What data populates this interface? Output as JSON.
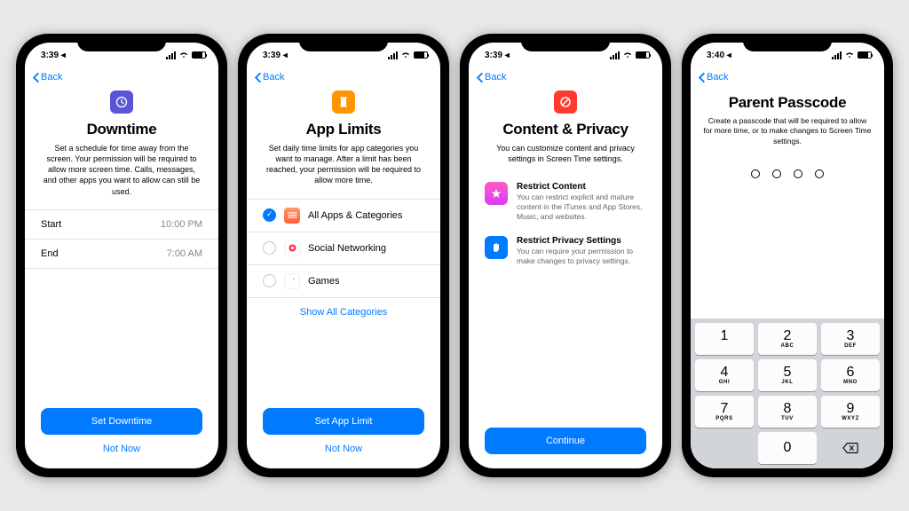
{
  "statusbar": {
    "time1": "3:39 ◂",
    "time4": "3:40 ◂"
  },
  "back_label": "Back",
  "phones": {
    "downtime": {
      "title": "Downtime",
      "desc": "Set a schedule for time away from the screen. Your permission will be required to allow more screen time. Calls, messages, and other apps you want to allow can still be used.",
      "start_label": "Start",
      "start_time": "10:00 PM",
      "end_label": "End",
      "end_time": "7:00 AM",
      "primary": "Set Downtime",
      "secondary": "Not Now"
    },
    "applimits": {
      "title": "App Limits",
      "desc": "Set daily time limits for app categories you want to manage. After a limit has been reached, your permission will be required to allow more time.",
      "cats": {
        "all": "All Apps & Categories",
        "social": "Social Networking",
        "games": "Games"
      },
      "show_all": "Show All Categories",
      "primary": "Set App Limit",
      "secondary": "Not Now"
    },
    "privacy": {
      "title": "Content & Privacy",
      "desc": "You can customize content and privacy settings in Screen Time settings.",
      "features": {
        "content_h": "Restrict Content",
        "content_p": "You can restrict explicit and mature content in the iTunes and App Stores, Music, and websites.",
        "priv_h": "Restrict Privacy Settings",
        "priv_p": "You can require your permission to make changes to privacy settings."
      },
      "primary": "Continue"
    },
    "passcode": {
      "title": "Parent Passcode",
      "desc": "Create a passcode that will be required to allow for more time, or to make changes to Screen Time settings.",
      "keys": {
        "k1": "1",
        "k2": "2",
        "k3": "3",
        "k4": "4",
        "k5": "5",
        "k6": "6",
        "k7": "7",
        "k8": "8",
        "k9": "9",
        "k0": "0",
        "s2": "ABC",
        "s3": "DEF",
        "s4": "GHI",
        "s5": "JKL",
        "s6": "MNO",
        "s7": "PQRS",
        "s8": "TUV",
        "s9": "WXYZ"
      }
    }
  }
}
